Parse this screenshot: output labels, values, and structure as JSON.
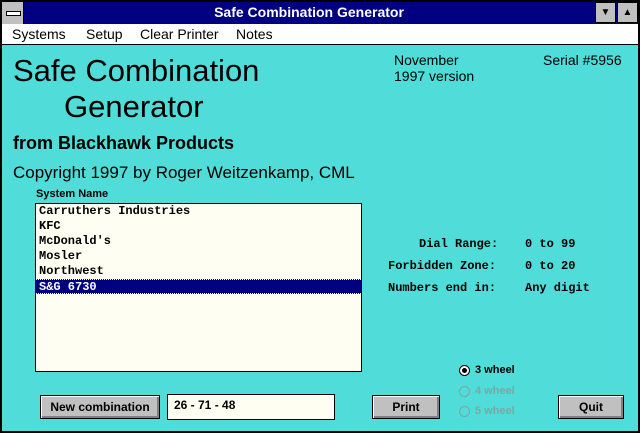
{
  "window": {
    "title": "Safe Combination Generator",
    "minimize_glyph": "▼",
    "maximize_glyph": "▲"
  },
  "menu": {
    "systems": "Systems",
    "setup": "Setup",
    "clear_printer": "Clear Printer",
    "notes": "Notes"
  },
  "header": {
    "title_line1": "Safe Combination",
    "title_line2": "Generator",
    "company": "from Blackhawk Products",
    "copyright": "Copyright 1997 by Roger Weitzenkamp, CML",
    "version_line1": "November",
    "version_line2": "1997 version",
    "serial": "Serial #5956"
  },
  "systems": {
    "label": "System Name",
    "items": [
      "Carruthers Industries",
      "KFC",
      "McDonald's",
      "Mosler",
      "Northwest",
      "S&G 6730"
    ],
    "selected_index": 5
  },
  "details": {
    "dial_range_label": "Dial Range:",
    "dial_range_value": "0 to 99",
    "forbidden_zone_label": "Forbidden Zone:",
    "forbidden_zone_value": "0 to 20",
    "numbers_end_label": "Numbers end in:",
    "numbers_end_value": "Any digit"
  },
  "wheels": {
    "options": [
      "3 wheel",
      "4 wheel",
      "5 wheel"
    ],
    "selected": "3 wheel",
    "disabled": [
      "4 wheel",
      "5 wheel"
    ]
  },
  "buttons": {
    "new_combination": "New combination",
    "print": "Print",
    "quit": "Quit"
  },
  "result": {
    "combination": "26 - 71 - 48"
  },
  "colors": {
    "background": "#50dcd8",
    "titlebar": "#000080",
    "selection": "#000080",
    "listbox": "#fffef2"
  }
}
